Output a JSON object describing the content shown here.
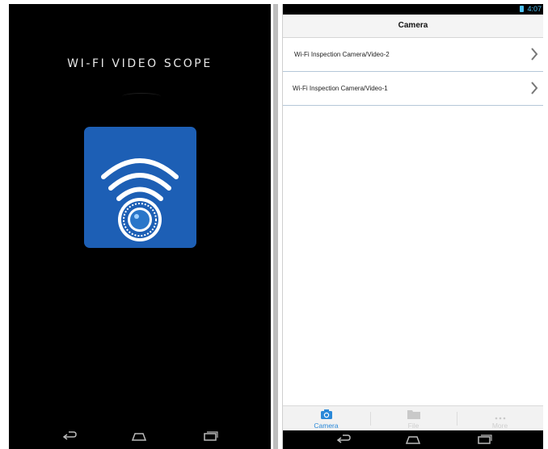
{
  "splash": {
    "title": "WI-FI VIDEO SCOPE",
    "icon": "wifi-scope-app-icon",
    "icon_color": "#1d5fb5"
  },
  "status_bar": {
    "time": "4:07",
    "battery_icon": "battery-icon",
    "accent": "#4fc3f7"
  },
  "header": {
    "title": "Camera"
  },
  "camera_list": [
    {
      "label": "Wi-Fi Inspection Camera/Video-2"
    },
    {
      "label": "Wi-Fi Inspection Camera/Video-1"
    }
  ],
  "tabs": [
    {
      "label": "Camera",
      "icon": "camera-icon",
      "active": true,
      "color": "#2a88d8"
    },
    {
      "label": "File",
      "icon": "folder-icon",
      "active": false,
      "color": "#cfcfcf"
    },
    {
      "label": "More",
      "icon": "more-icon",
      "active": false,
      "color": "#cfcfcf"
    }
  ],
  "nav_bar": {
    "back_icon": "back-icon",
    "home_icon": "home-icon",
    "recents_icon": "recents-icon"
  }
}
